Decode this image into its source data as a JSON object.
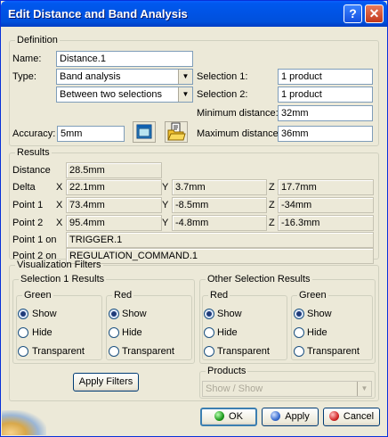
{
  "window": {
    "title": "Edit Distance and Band Analysis",
    "help_label": "?",
    "close_label": "✕"
  },
  "definition": {
    "legend": "Definition",
    "name_label": "Name:",
    "name_value": "Distance.1",
    "type_label": "Type:",
    "type_value": "Band analysis",
    "mode_value": "Between two selections",
    "selection1_label": "Selection 1:",
    "selection1_value": "1 product",
    "selection2_label": "Selection 2:",
    "selection2_value": "1 product",
    "min_label": "Minimum distance:",
    "min_value": "32mm",
    "accuracy_label": "Accuracy:",
    "accuracy_value": "5mm",
    "max_label": "Maximum distance:",
    "max_value": "36mm"
  },
  "results": {
    "legend": "Results",
    "distance_label": "Distance",
    "distance_value": "28.5mm",
    "axis_x": "X",
    "axis_y": "Y",
    "axis_z": "Z",
    "rows": [
      {
        "label": "Delta",
        "x": "22.1mm",
        "y": "3.7mm",
        "z": "17.7mm"
      },
      {
        "label": "Point 1",
        "x": "73.4mm",
        "y": "-8.5mm",
        "z": "-34mm"
      },
      {
        "label": "Point 2",
        "x": "95.4mm",
        "y": "-4.8mm",
        "z": "-16.3mm"
      }
    ],
    "point1_on_label": "Point 1 on",
    "point1_on_value": "TRIGGER.1",
    "point2_on_label": "Point 2 on",
    "point2_on_value": "REGULATION_COMMAND.1"
  },
  "viz": {
    "legend": "Visualization Filters",
    "sel1": {
      "legend": "Selection 1 Results",
      "green": {
        "legend": "Green",
        "options": [
          "Show",
          "Hide",
          "Transparent"
        ],
        "selected": 0
      },
      "red": {
        "legend": "Red",
        "options": [
          "Show",
          "Hide",
          "Transparent"
        ],
        "selected": 0
      }
    },
    "other": {
      "legend": "Other Selection Results",
      "red": {
        "legend": "Red",
        "options": [
          "Show",
          "Hide",
          "Transparent"
        ],
        "selected": 0
      },
      "green": {
        "legend": "Green",
        "options": [
          "Show",
          "Hide",
          "Transparent"
        ],
        "selected": 0
      }
    },
    "apply_filters_label": "Apply Filters",
    "products": {
      "legend": "Products",
      "value": "Show / Show"
    }
  },
  "footer": {
    "ok_label": "OK",
    "apply_label": "Apply",
    "cancel_label": "Cancel"
  }
}
